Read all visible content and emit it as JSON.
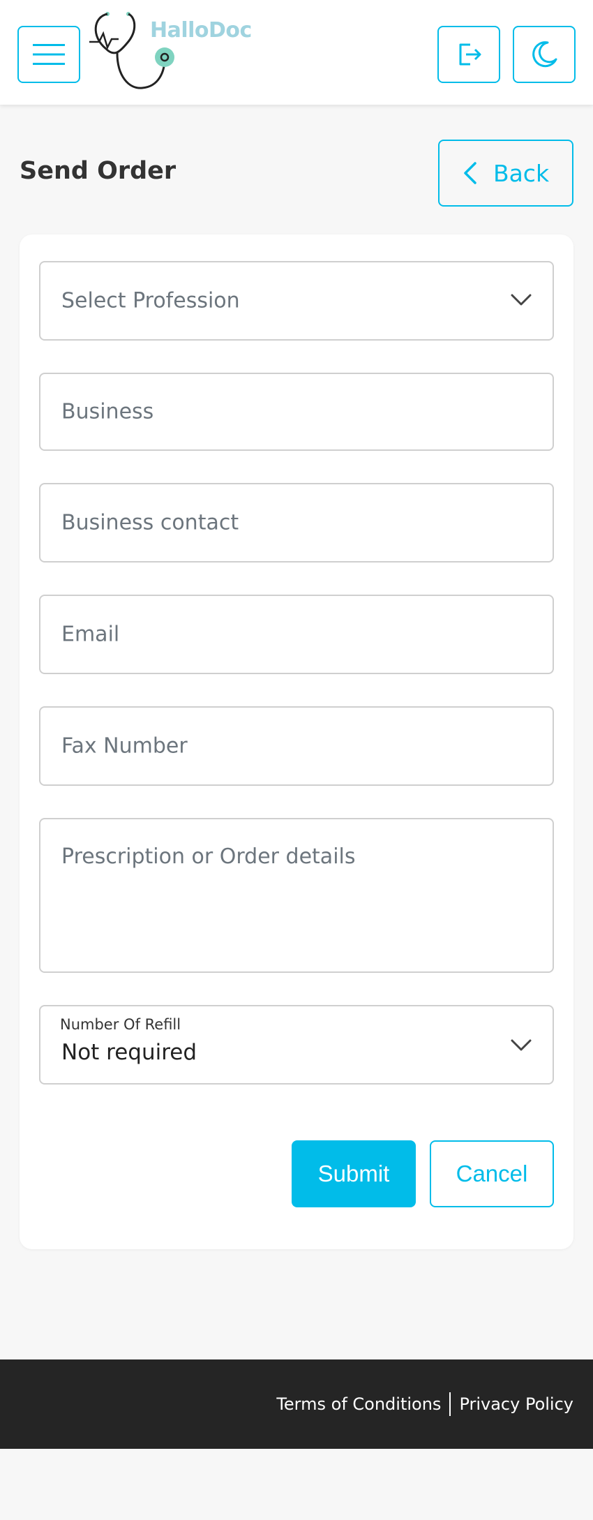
{
  "header": {
    "brand": "HalloDoc",
    "icons": {
      "menu": "hamburger-icon",
      "logout": "logout-icon",
      "theme": "moon-icon"
    }
  },
  "page": {
    "title": "Send Order",
    "back_label": "Back"
  },
  "form": {
    "profession_placeholder": "Select Profession",
    "business_placeholder": "Business",
    "business_contact_placeholder": "Business contact",
    "email_placeholder": "Email",
    "fax_placeholder": "Fax Number",
    "details_placeholder": "Prescription or Order details",
    "refill_label": "Number Of Refill",
    "refill_value": "Not required",
    "submit_label": "Submit",
    "cancel_label": "Cancel"
  },
  "footer": {
    "terms_label": "Terms of Conditions",
    "privacy_label": "Privacy Policy"
  },
  "colors": {
    "accent": "#01bce9",
    "footer_bg": "#252525",
    "page_bg": "#f7f7f7"
  }
}
